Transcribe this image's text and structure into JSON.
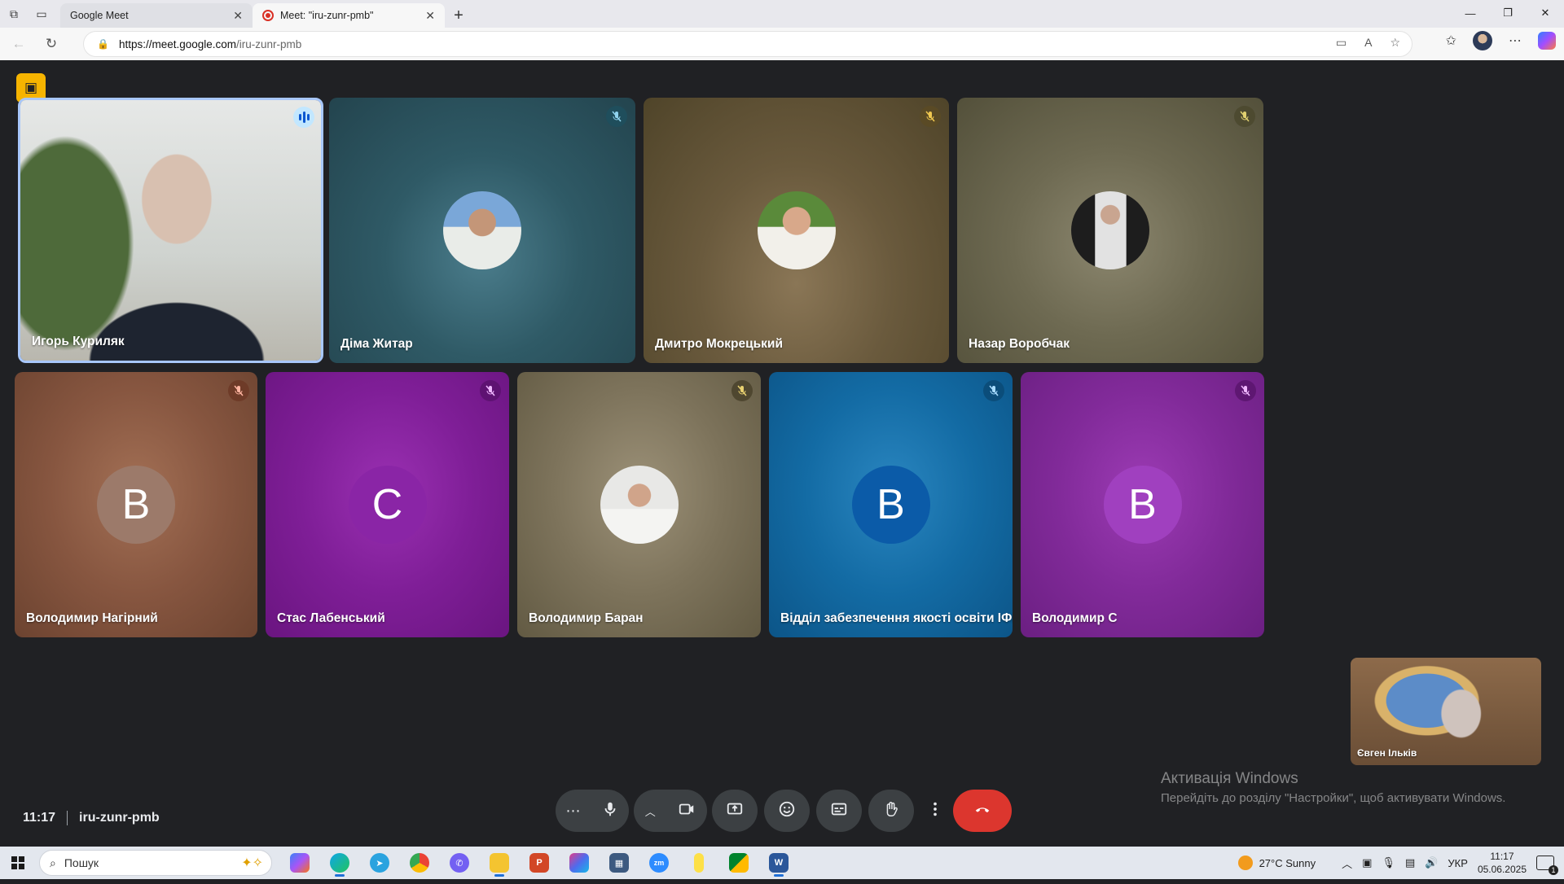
{
  "browser": {
    "tabs": [
      {
        "title": "Google Meet"
      },
      {
        "title": "Meet: \"iru-zunr-pmb\""
      }
    ],
    "url_host": "https://meet.google.com",
    "url_path": "/iru-zunr-pmb"
  },
  "meet": {
    "time": "11:17",
    "code": "iru-zunr-pmb",
    "participants_count": "10",
    "colors": {
      "active_border": "#a8c7fa",
      "end_call": "#dc362e",
      "visibility_button": "#f6b400"
    },
    "tiles": [
      {
        "name": "Игорь Куриляк",
        "type": "video",
        "speaking": true
      },
      {
        "name": "Діма Житар",
        "type": "photo"
      },
      {
        "name": "Дмитро Мокрецький",
        "type": "photo"
      },
      {
        "name": "Назар Воробчак",
        "type": "photo"
      },
      {
        "name": "Володимир Нагірний",
        "type": "letter",
        "letter": "В"
      },
      {
        "name": "Стас Лабенський",
        "type": "letter",
        "letter": "С"
      },
      {
        "name": "Володимир Баран",
        "type": "photo"
      },
      {
        "name": "Відділ забезпечення якості освіти ІФНТУ...",
        "type": "letter",
        "letter": "В"
      },
      {
        "name": "Володимир С",
        "type": "letter",
        "letter": "В"
      }
    ],
    "self_view_name": "Євген Ільків"
  },
  "watermark": {
    "line1": "Активація Windows",
    "line2": "Перейдіть до розділу \"Настройки\", щоб активувати Windows."
  },
  "taskbar": {
    "search_placeholder": "Пошук",
    "weather": "27°C  Sunny",
    "language": "УКР",
    "time": "11:17",
    "date": "05.06.2025",
    "notifications": "1"
  }
}
